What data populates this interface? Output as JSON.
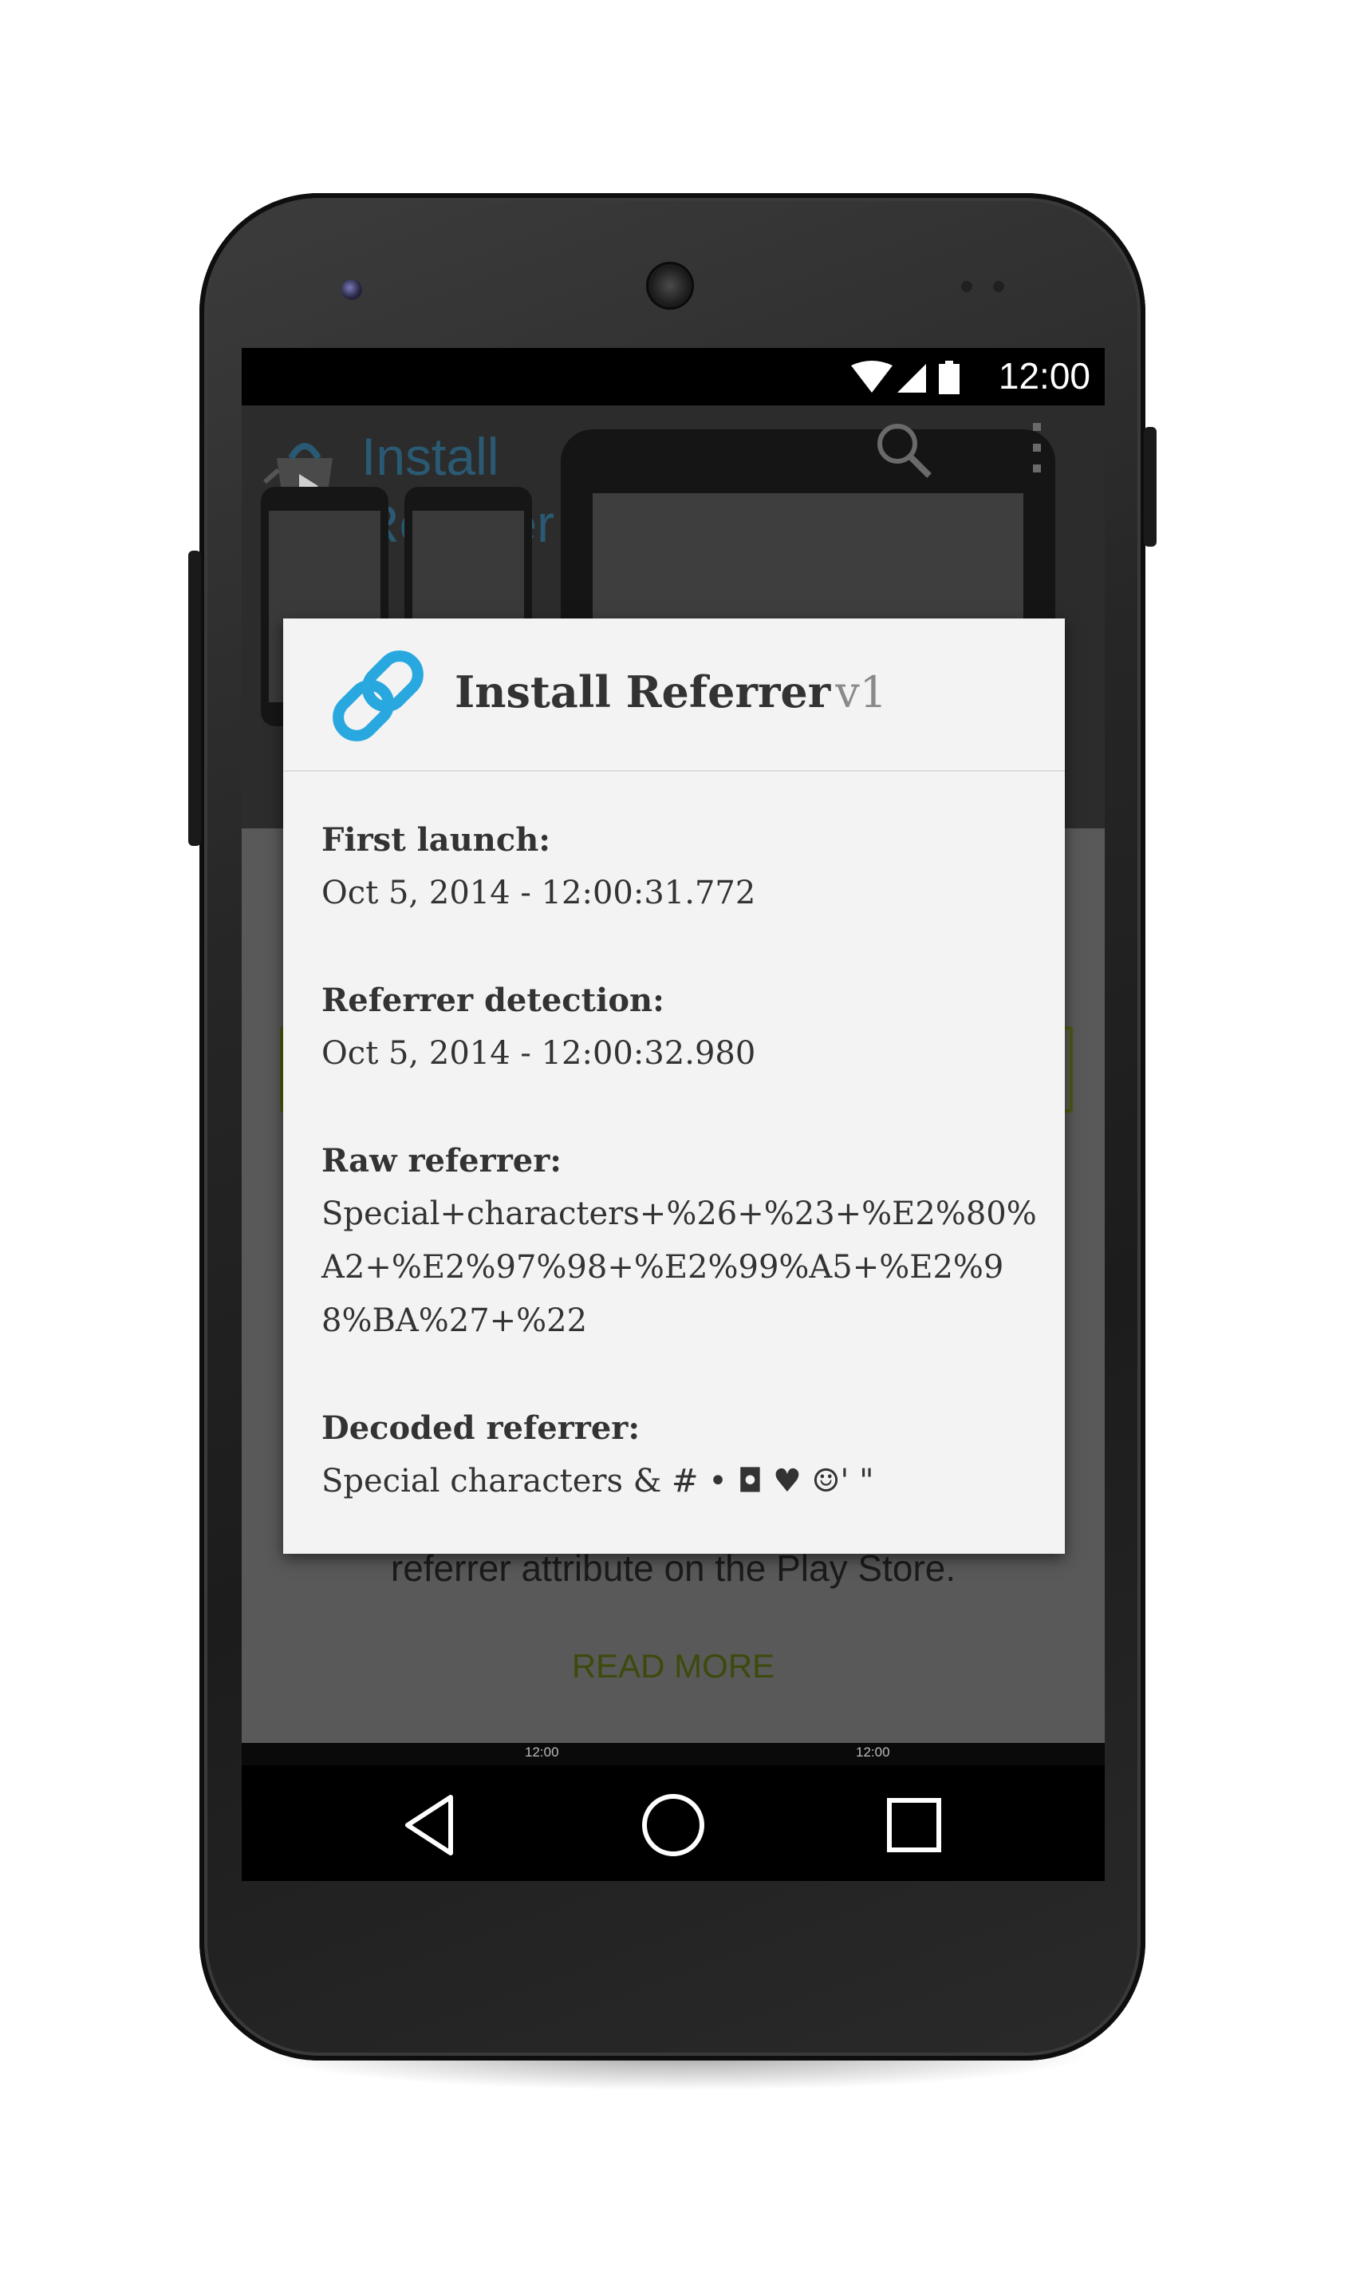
{
  "status_bar": {
    "time": "12:00"
  },
  "background_app": {
    "logo_text_line1": "Install",
    "logo_text_line2": "Referrer",
    "description_fragment": "referrer attribute on the Play Store.",
    "read_more": "READ MORE",
    "mini_time_1": "12:00",
    "mini_time_2": "12:00"
  },
  "dialog": {
    "title": "Install Referrer",
    "version": "v1",
    "fields": [
      {
        "label": "First launch:",
        "value": "Oct 5, 2014 - 12:00:31.772"
      },
      {
        "label": "Referrer detection:",
        "value": "Oct 5, 2014 - 12:00:32.980"
      },
      {
        "label": "Raw referrer:",
        "value": "Special+characters+%26+%23+%E2%80%A2+%E2%97%98+%E2%99%A5+%E2%98%BA%27+%22"
      },
      {
        "label": "Decoded referrer:",
        "value": "Special characters & # • ◘ ♥ ☺' \""
      }
    ]
  },
  "colors": {
    "link_icon": "#29a8e0",
    "dialog_bg": "#f3f3f3",
    "read_more": "#3c4a0c"
  },
  "icons": [
    "wifi-icon",
    "signal-icon",
    "battery-icon",
    "link-icon",
    "search-icon",
    "overflow-menu-icon",
    "back-icon",
    "home-icon",
    "recents-icon"
  ]
}
